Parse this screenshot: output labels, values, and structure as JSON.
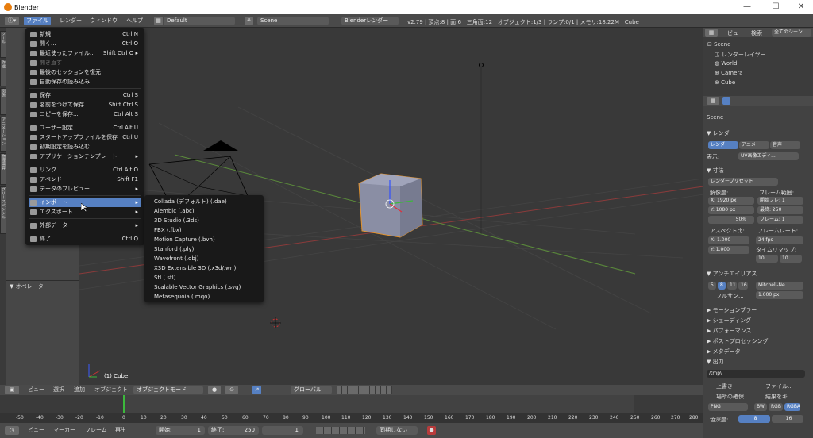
{
  "window": {
    "title": "Blender",
    "min": "—",
    "max": "☐",
    "close": "✕"
  },
  "topbar": {
    "menus": [
      "ファイル",
      "レンダー",
      "ウィンドウ",
      "ヘルプ"
    ],
    "layout": "Default",
    "scene": "Scene",
    "engine": "Blenderレンダー",
    "stats": "v2.79 | 頂点:8 | 面:6 | 三角面:12 | オブジェクト:1/3 | ランプ:0/1 | メモリ:18.22M | Cube"
  },
  "file_menu": [
    {
      "label": "新規",
      "shortcut": "Ctrl N",
      "state": "normal",
      "sep_after": false
    },
    {
      "label": "開く...",
      "shortcut": "Ctrl O",
      "state": "normal",
      "sep_after": false
    },
    {
      "label": "最近使ったファイル...",
      "shortcut": "Shift Ctrl O ▸",
      "state": "normal",
      "sep_after": false
    },
    {
      "label": "開き直す",
      "shortcut": "",
      "state": "dis",
      "sep_after": false
    },
    {
      "label": "最後のセッションを復元",
      "shortcut": "",
      "state": "normal",
      "sep_after": false
    },
    {
      "label": "自動保存の読み込み...",
      "shortcut": "",
      "state": "normal",
      "sep_after": true
    },
    {
      "label": "保存",
      "shortcut": "Ctrl S",
      "state": "normal",
      "sep_after": false
    },
    {
      "label": "名前をつけて保存...",
      "shortcut": "Shift Ctrl S",
      "state": "normal",
      "sep_after": false
    },
    {
      "label": "コピーを保存...",
      "shortcut": "Ctrl Alt S",
      "state": "normal",
      "sep_after": true
    },
    {
      "label": "ユーザー設定...",
      "shortcut": "Ctrl Alt U",
      "state": "normal",
      "sep_after": false
    },
    {
      "label": "スタートアップファイルを保存",
      "shortcut": "Ctrl U",
      "state": "normal",
      "sep_after": false
    },
    {
      "label": "初期設定を読み込む",
      "shortcut": "",
      "state": "normal",
      "sep_after": false
    },
    {
      "label": "アプリケーションテンプレート",
      "shortcut": "▸",
      "state": "normal",
      "sep_after": true
    },
    {
      "label": "リンク",
      "shortcut": "Ctrl Alt O",
      "state": "normal",
      "sep_after": false
    },
    {
      "label": "アペンド",
      "shortcut": "Shift F1",
      "state": "normal",
      "sep_after": false
    },
    {
      "label": "データのプレビュー",
      "shortcut": "▸",
      "state": "normal",
      "sep_after": true
    },
    {
      "label": "インポート",
      "shortcut": "▸",
      "state": "hl",
      "sep_after": false
    },
    {
      "label": "エクスポート",
      "shortcut": "▸",
      "state": "normal",
      "sep_after": true
    },
    {
      "label": "外部データ",
      "shortcut": "▸",
      "state": "normal",
      "sep_after": true
    },
    {
      "label": "終了",
      "shortcut": "Ctrl Q",
      "state": "normal",
      "sep_after": false
    }
  ],
  "import_menu": [
    "Collada (デフォルト) (.dae)",
    "Alembic (.abc)",
    "3D Studio (.3ds)",
    "FBX (.fbx)",
    "Motion Capture (.bvh)",
    "Stanford (.ply)",
    "Wavefront (.obj)",
    "X3D Extensible 3D (.x3d/.wrl)",
    "Stl (.stl)",
    "Scalable Vector Graphics (.svg)",
    "Metasequoia (.mqo)"
  ],
  "left": {
    "tabs": [
      "ツール",
      "作成",
      "関係",
      "アニメーション",
      "物理演算",
      "グリースペンシル"
    ],
    "operator": "▼ オペレーター"
  },
  "viewport": {
    "object_label": "(1) Cube"
  },
  "outliner": {
    "view": "ビュー",
    "search": "検索",
    "scenes": "全てのシーン",
    "items": [
      "Scene",
      "レンダーレイヤー",
      "World",
      "Camera",
      "Cube"
    ]
  },
  "props": {
    "scene": "Scene",
    "render": "▼ レンダー",
    "tabs": [
      "レンダ",
      "アニメ",
      "音声"
    ],
    "display_label": "表示:",
    "display_val": "UV画像エディ...",
    "dims": "▼ 寸法",
    "preset": "レンダープリセット",
    "res_label": "解像度:",
    "frame_label": "フレーム範囲:",
    "x": "X: 1920 px",
    "y": "Y: 1080 px",
    "pct": "50%",
    "start": "開始フレ: 1",
    "end": "最終: 250",
    "step": "フレーム: 1",
    "aspect_label": "アスペクト比:",
    "fps_label": "フレームレート:",
    "ax": "X: 1.000",
    "ay": "Y: 1.000",
    "fps": "24 fps",
    "remap": "タイムリマップ:",
    "remap_a": "10",
    "remap_b": "10",
    "aa": "▼ アンチエイリアス",
    "aa_vals": [
      "5",
      "8",
      "11",
      "16"
    ],
    "filter": "Mitchell-Ne...",
    "full": "フルサン...",
    "px": "1.000 px",
    "sections": [
      "▶ モーションブラー",
      "▶ シェーディング",
      "▶ パフォーマンス",
      "▶ ポストプロセッシング",
      "▶ メタデータ",
      "▼ 出力"
    ],
    "path": "/tmp\\",
    "overwrite": "上書き",
    "file": "ファイル...",
    "placeholder": "場所の確保",
    "cache": "結果をキ...",
    "format": "PNG",
    "bw": "BW",
    "rgb": "RGB",
    "rgba": "RGBA",
    "depth_label": "色深度:",
    "d8": "8",
    "d16": "16"
  },
  "view3d_hdr": {
    "items": [
      "ビュー",
      "選択",
      "追加",
      "オブジェクト"
    ],
    "mode": "オブジェクトモード",
    "orient": "グローバル"
  },
  "timeline": {
    "ticks": [
      "-50",
      "-40",
      "-30",
      "-20",
      "-10",
      "0",
      "10",
      "20",
      "30",
      "40",
      "50",
      "60",
      "70",
      "80",
      "90",
      "100",
      "110",
      "120",
      "130",
      "140",
      "150",
      "160",
      "170",
      "180",
      "190",
      "200",
      "210",
      "220",
      "230",
      "240",
      "250",
      "260",
      "270",
      "280"
    ]
  },
  "tl_hdr": {
    "items": [
      "ビュー",
      "マーカー",
      "フレーム",
      "再生"
    ],
    "start": "開始:",
    "start_v": "1",
    "end": "終了:",
    "end_v": "250",
    "cur": "1",
    "sync": "同期しない"
  }
}
